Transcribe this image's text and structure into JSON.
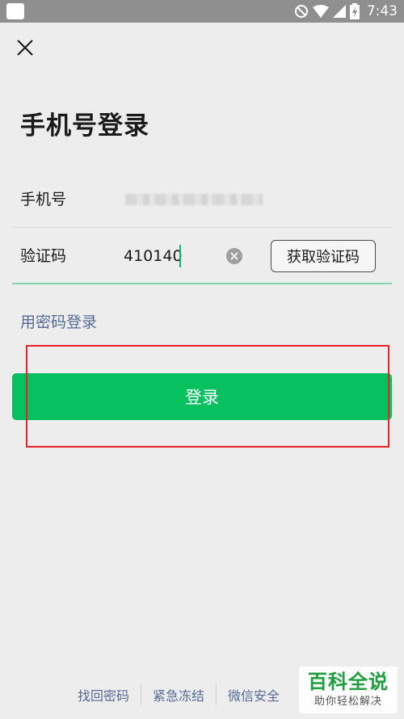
{
  "status_bar": {
    "time": "7:43",
    "icons": [
      "app-icon",
      "do-not-disturb-icon",
      "wifi-icon",
      "signal-icon",
      "battery-charging-icon"
    ]
  },
  "header": {
    "close_icon": "close-icon",
    "title": "手机号登录"
  },
  "form": {
    "phone": {
      "label": "手机号",
      "value_masked": true
    },
    "code": {
      "label": "验证码",
      "value": "410140",
      "clear_icon": "clear-icon",
      "get_code_label": "获取验证码"
    },
    "password_login_label": "用密码登录",
    "login_label": "登录"
  },
  "footer": {
    "links": [
      "找回密码",
      "紧急冻结",
      "微信安全"
    ]
  },
  "watermark": {
    "title": "百科全说",
    "subtitle": "助你轻松解决"
  },
  "colors": {
    "background": "#ededed",
    "accent_green": "#07c160",
    "link_blue": "#576b95",
    "highlight_red": "#e8212b",
    "status_bar": "#8f8f8f"
  }
}
